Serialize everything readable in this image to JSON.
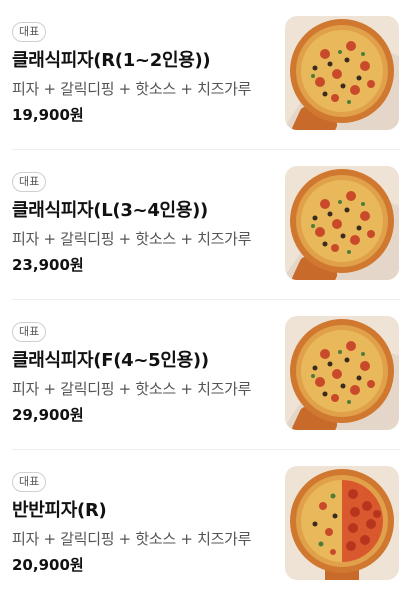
{
  "menu": {
    "items": [
      {
        "badge": "대표",
        "name": "클래식피자(R(1~2인용))",
        "description": "피자 + 갈릭디핑 + 핫소스 + 치즈가루",
        "price": "19,900원",
        "image": "classic-pizza-photo"
      },
      {
        "badge": "대표",
        "name": "클래식피자(L(3~4인용))",
        "description": "피자 + 갈릭디핑 + 핫소스 + 치즈가루",
        "price": "23,900원",
        "image": "classic-pizza-photo"
      },
      {
        "badge": "대표",
        "name": "클래식피자(F(4~5인용))",
        "description": "피자 + 갈릭디핑 + 핫소스 + 치즈가루",
        "price": "29,900원",
        "image": "classic-pizza-photo"
      },
      {
        "badge": "대표",
        "name": "반반피자(R)",
        "description": "피자 + 갈릭디핑 + 핫소스 + 치즈가루",
        "price": "20,900원",
        "image": "half-half-pizza-photo"
      }
    ]
  }
}
